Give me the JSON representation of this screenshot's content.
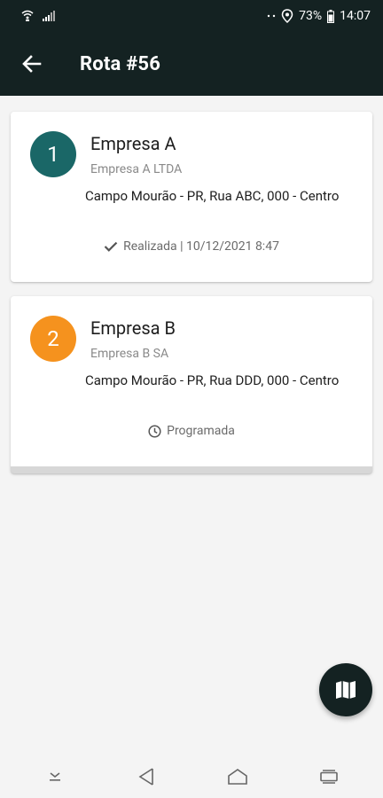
{
  "status_bar": {
    "battery": "73%",
    "time": "14:07",
    "icons": [
      "wifi-calling-icon",
      "signal-icon",
      "dots-icon",
      "location-icon",
      "battery-icon"
    ]
  },
  "app_bar": {
    "title": "Rota #56",
    "back_icon": "arrow-left-icon",
    "background": "#142222"
  },
  "stops": [
    {
      "number": "1",
      "name": "Empresa A",
      "legal_name": "Empresa A LTDA",
      "address": "Campo Mourão - PR, Rua ABC, 000 - Centro",
      "status": "Realizada | 10/12/2021 8:47",
      "status_icon": "check-icon",
      "color": "#1a6767"
    },
    {
      "number": "2",
      "name": "Empresa B",
      "legal_name": "Empresa B SA",
      "address": "Campo Mourão - PR, Rua DDD, 000 - Centro",
      "status": "Programada",
      "status_icon": "clock-icon",
      "color": "#f5921e"
    }
  ],
  "fab": {
    "icon": "map-icon"
  },
  "nav_bar": {
    "icons": [
      "hide-keyboard-icon",
      "back-triangle-icon",
      "home-icon",
      "recents-icon"
    ]
  }
}
